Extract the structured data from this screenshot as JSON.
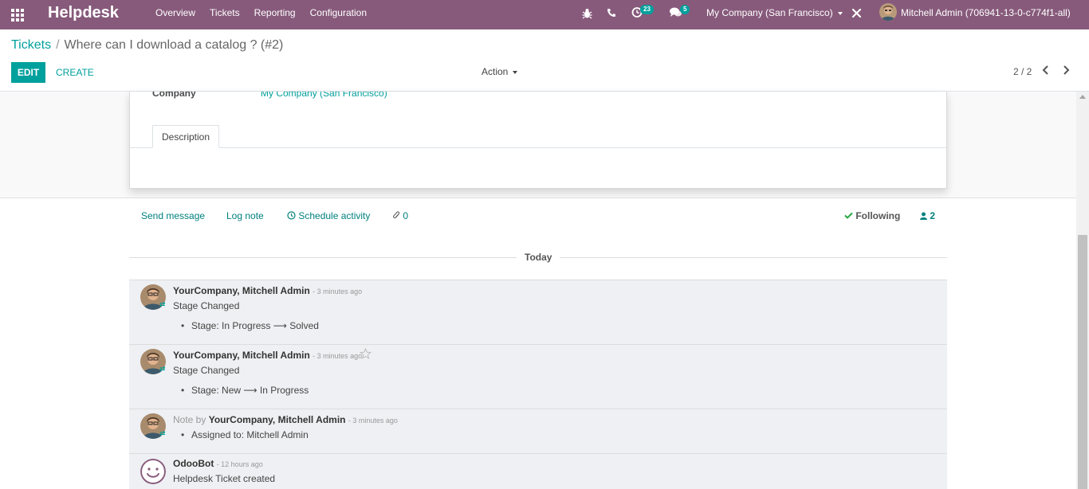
{
  "navbar": {
    "brand": "Helpdesk",
    "menu": [
      "Overview",
      "Tickets",
      "Reporting",
      "Configuration"
    ],
    "activity_count": "23",
    "messages_count": "5",
    "company": "My Company (San Francisco)",
    "user": "Mitchell Admin (706941-13-0-c774f1-all)",
    "icons": [
      "apps-icon",
      "bug-icon",
      "phone-icon",
      "clock-icon",
      "chat-icon",
      "tools-icon"
    ]
  },
  "control": {
    "breadcrumb_parent": "Tickets",
    "breadcrumb_separator": "/",
    "breadcrumb_current": "Where can I download a catalog ? (#2)",
    "edit_label": "EDIT",
    "create_label": "CREATE",
    "action_label": "Action",
    "pager": "2 / 2"
  },
  "form": {
    "company_label": "Company",
    "company_value": "My Company (San Francisco)",
    "tab_description": "Description"
  },
  "chatter": {
    "send_message": "Send message",
    "log_note": "Log note",
    "schedule_activity": "Schedule activity",
    "attachments": "0",
    "following": "Following",
    "followers": "2",
    "today": "Today",
    "messages": [
      {
        "author": "YourCompany, Mitchell Admin",
        "date": "- 3 minutes ago",
        "title": "Stage Changed",
        "bullet": "Stage: In Progress ⟶ Solved"
      },
      {
        "author": "YourCompany, Mitchell Admin",
        "date": "- 3 minutes ago",
        "title": "Stage Changed",
        "bullet": "Stage: New ⟶ In Progress"
      },
      {
        "note_prefix": "Note by",
        "author": "YourCompany, Mitchell Admin",
        "date": "- 3 minutes ago",
        "bullet": "Assigned to: Mitchell Admin"
      },
      {
        "author": "OdooBot",
        "date": "- 12 hours ago",
        "title": "Helpdesk Ticket created"
      }
    ]
  },
  "colors": {
    "navbar": "#875a7b",
    "accent": "#00a09d",
    "message_bg": "#eef0f3"
  }
}
